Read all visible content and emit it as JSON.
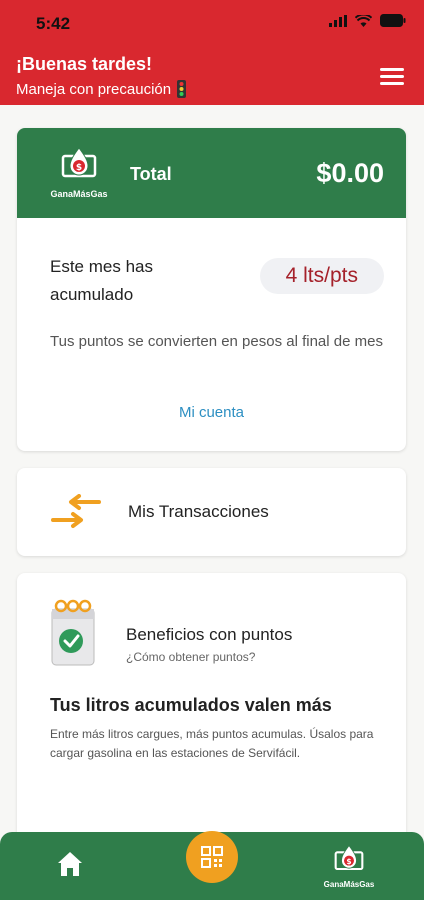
{
  "status_bar": {
    "time": "5:42"
  },
  "header": {
    "greeting": "¡Buenas tardes!",
    "subtitle": "Maneja con precaución"
  },
  "total_card": {
    "brand_label": "GanaMásGas",
    "total_label": "Total",
    "total_value": "$0.00",
    "accumulated_label_line1": "Este mes has",
    "accumulated_label_line2": "acumulado",
    "points": "4 lts/pts",
    "note": "Tus puntos se convierten en pesos al final de mes",
    "account_link": "Mi cuenta"
  },
  "transactions_card": {
    "title": "Mis Transacciones"
  },
  "benefits_card": {
    "title": "Beneficios con puntos",
    "subtitle": "¿Cómo obtener puntos?",
    "heading": "Tus litros acumulados valen más",
    "body": "Entre más litros cargues, más puntos acumulas. Úsalos para cargar gasolina en las estaciones de Servifácil."
  },
  "bottom_nav": {
    "brand_label": "GanaMásGas"
  },
  "colors": {
    "header_red": "#d9282f",
    "brand_green": "#2f7d4a",
    "accent_orange": "#f0a020",
    "points_red": "#a5212a",
    "link_blue": "#2d8fc2"
  }
}
